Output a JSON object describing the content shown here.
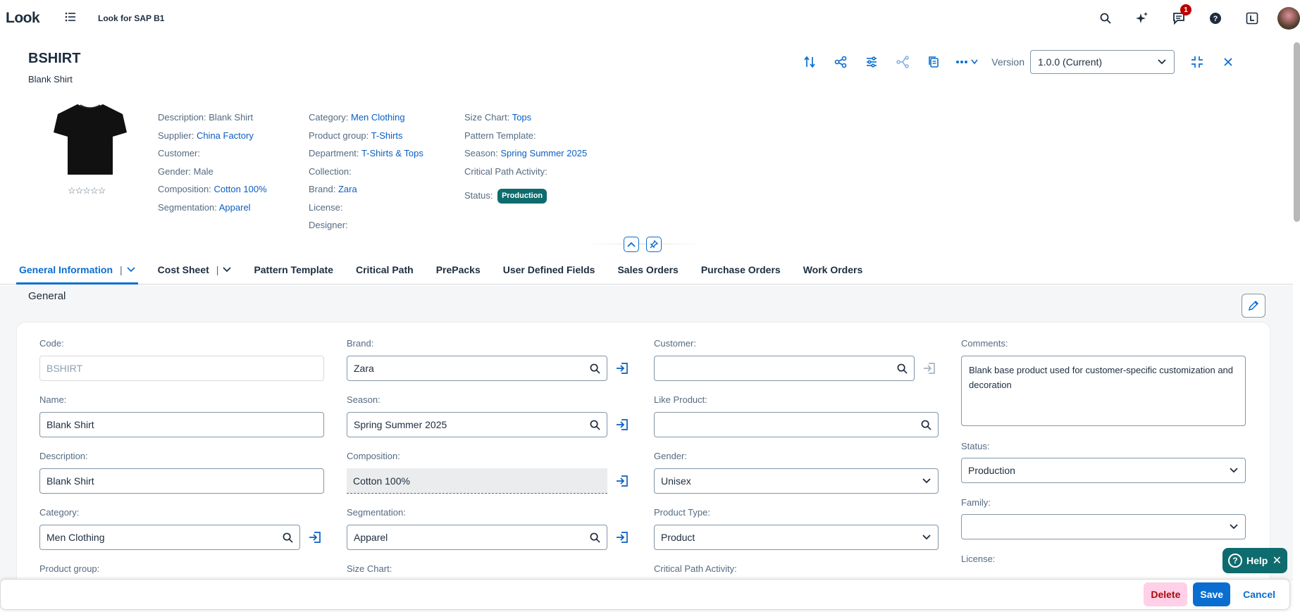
{
  "shell": {
    "logo": "Look",
    "app_title": "Look for SAP B1",
    "notification_count": "1"
  },
  "header": {
    "title": "BSHIRT",
    "subtitle": "Blank Shirt",
    "version_label": "Version",
    "version_value": "1.0.0 (Current)",
    "rating_stars": "☆☆☆☆☆",
    "col1": [
      {
        "label": "Description:",
        "value": "Blank Shirt",
        "link": false
      },
      {
        "label": "Supplier:",
        "value": "China Factory",
        "link": true
      },
      {
        "label": "Customer:",
        "value": "",
        "link": false
      },
      {
        "label": "Gender:",
        "value": "Male",
        "link": false
      },
      {
        "label": "Composition:",
        "value": "Cotton 100%",
        "link": true
      },
      {
        "label": "Segmentation:",
        "value": "Apparel",
        "link": true
      }
    ],
    "col2": [
      {
        "label": "Category:",
        "value": "Men Clothing",
        "link": true
      },
      {
        "label": "Product group:",
        "value": "T-Shirts",
        "link": true
      },
      {
        "label": "Department:",
        "value": "T-Shirts & Tops",
        "link": true
      },
      {
        "label": "Collection:",
        "value": "",
        "link": false
      },
      {
        "label": "Brand:",
        "value": "Zara",
        "link": true
      },
      {
        "label": "License:",
        "value": "",
        "link": false
      },
      {
        "label": "Designer:",
        "value": "",
        "link": false
      }
    ],
    "col3": [
      {
        "label": "Size Chart:",
        "value": "Tops",
        "link": true
      },
      {
        "label": "Pattern Template:",
        "value": "",
        "link": false
      },
      {
        "label": "Season:",
        "value": "Spring Summer 2025",
        "link": true
      },
      {
        "label": "Critical Path Activity:",
        "value": "",
        "link": false
      }
    ],
    "status_label": "Status:",
    "status_value": "Production"
  },
  "tabs": [
    {
      "label": "General Information",
      "dropdown": true,
      "active": true
    },
    {
      "label": "Cost Sheet",
      "dropdown": true,
      "active": false
    },
    {
      "label": "Pattern Template",
      "dropdown": false,
      "active": false
    },
    {
      "label": "Critical Path",
      "dropdown": false,
      "active": false
    },
    {
      "label": "PrePacks",
      "dropdown": false,
      "active": false
    },
    {
      "label": "User Defined Fields",
      "dropdown": false,
      "active": false
    },
    {
      "label": "Sales Orders",
      "dropdown": false,
      "active": false
    },
    {
      "label": "Purchase Orders",
      "dropdown": false,
      "active": false
    },
    {
      "label": "Work Orders",
      "dropdown": false,
      "active": false
    }
  ],
  "section": {
    "title": "General"
  },
  "form": {
    "code_label": "Code:",
    "code_value": "BSHIRT",
    "name_label": "Name:",
    "name_value": "Blank Shirt",
    "description_label": "Description:",
    "description_value": "Blank Shirt",
    "category_label": "Category:",
    "category_value": "Men Clothing",
    "product_group_label": "Product group:",
    "brand_label": "Brand:",
    "brand_value": "Zara",
    "season_label": "Season:",
    "season_value": "Spring Summer 2025",
    "composition_label": "Composition:",
    "composition_value": "Cotton 100%",
    "segmentation_label": "Segmentation:",
    "segmentation_value": "Apparel",
    "size_chart_label": "Size Chart:",
    "customer_label": "Customer:",
    "customer_value": "",
    "like_product_label": "Like Product:",
    "like_product_value": "",
    "gender_label": "Gender:",
    "gender_value": "Unisex",
    "product_type_label": "Product Type:",
    "product_type_value": "Product",
    "critical_path_label": "Critical Path Activity:",
    "comments_label": "Comments:",
    "comments_value": "Blank base product used for customer-specific customization and decoration",
    "status_label": "Status:",
    "status_value": "Production",
    "family_label": "Family:",
    "family_value": "",
    "license_label": "License:"
  },
  "help": {
    "label": "Help"
  },
  "footer": {
    "delete_label": "Delete",
    "save_label": "Save",
    "cancel_label": "Cancel"
  }
}
